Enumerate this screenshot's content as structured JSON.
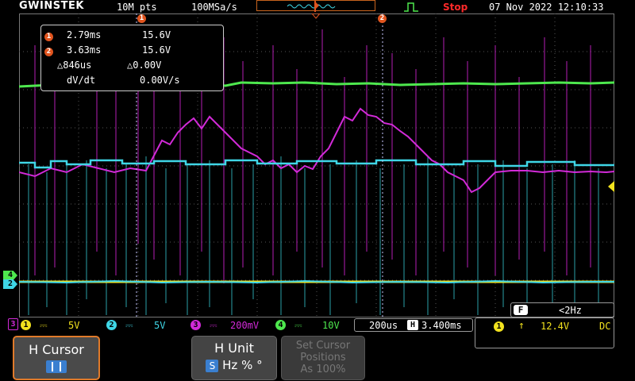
{
  "header": {
    "brand": "GWINSTEK",
    "memory": "10M pts",
    "sample_rate": "100MSa/s",
    "run_state": "Stop",
    "datetime": "07 Nov 2022 12:10:33"
  },
  "cursor_panel": {
    "c1_num": "1",
    "c1_time": "2.79ms",
    "c1_volt": "15.6V",
    "c2_num": "2",
    "c2_time": "3.63ms",
    "c2_volt": "15.6V",
    "delta_t": "△846us",
    "delta_v": "△0.00V",
    "dvdt_label": "dV/dt",
    "dvdt_value": "0.00V/s"
  },
  "markers": {
    "cursor1": "1",
    "cursor2": "2",
    "ch4": "4",
    "ch2": "2",
    "ch3": "3"
  },
  "channels": [
    {
      "num": "1",
      "coupling": "DC",
      "scale": "5V",
      "color": "#f2e21e"
    },
    {
      "num": "2",
      "coupling": "DC",
      "scale": "5V",
      "color": "#3fd6e6"
    },
    {
      "num": "3",
      "coupling": "DC",
      "scale": "200mV",
      "color": "#d22ad8"
    },
    {
      "num": "4",
      "coupling": "DC",
      "scale": "10V",
      "color": "#4ee84e"
    }
  ],
  "timebase": {
    "scale": "200us",
    "position": "3.400ms"
  },
  "trigger": {
    "source": "1",
    "level": "12.4V",
    "coupling": "DC",
    "freq_icon": "F",
    "frequency": "<2Hz"
  },
  "softkeys": {
    "k1_title": "H Cursor",
    "k2_title": "H Unit",
    "k2_s": "S",
    "k2_opts": "Hz % °",
    "k3_line1": "Set Cursor",
    "k3_line2": "Positions",
    "k3_line3": "As 100%"
  },
  "colors": {
    "ch1": "#f2e21e",
    "ch2": "#3fd6e6",
    "ch3": "#d22ad8",
    "ch4": "#4ee84e",
    "cursor": "#e0541e",
    "stop": "#ff2a2a"
  }
}
